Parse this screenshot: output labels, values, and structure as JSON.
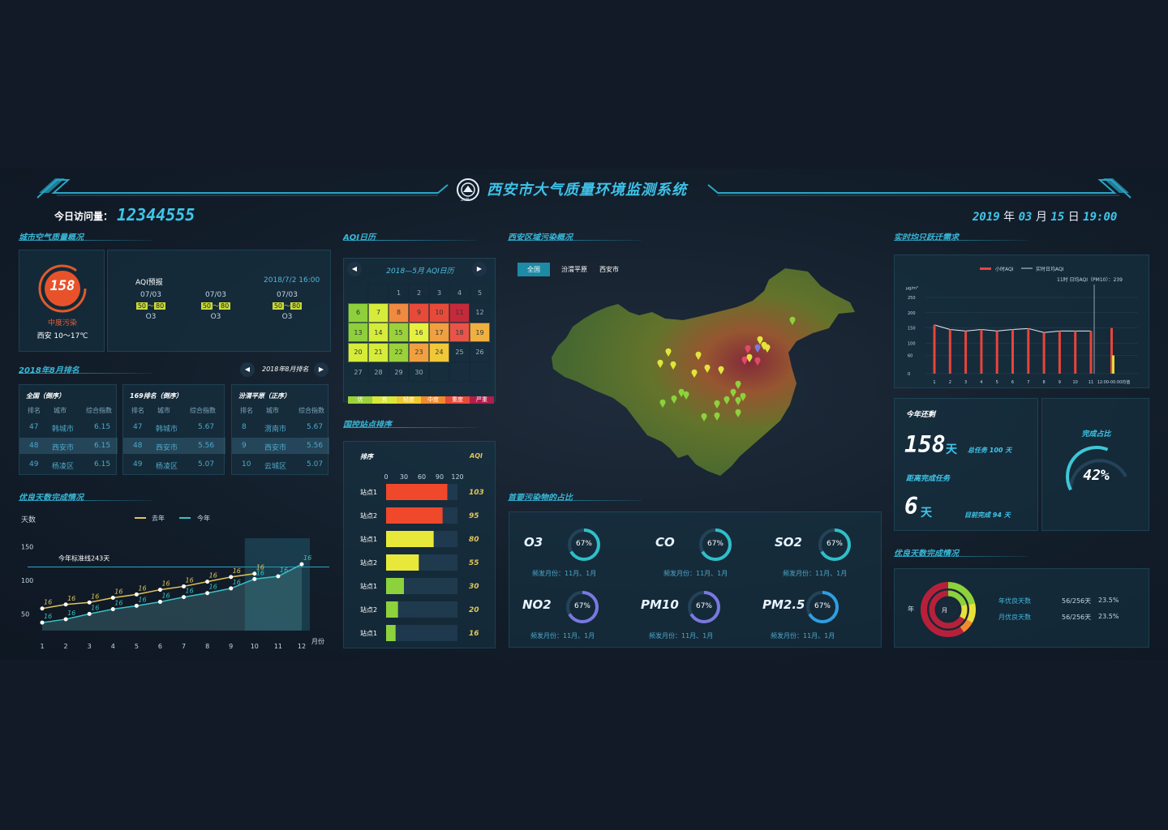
{
  "header": {
    "title": "西安市大气质量环境监测系统",
    "visits_label": "今日访问量：",
    "visits_value": "12344555",
    "date": {
      "year": "2019",
      "year_unit": "年",
      "month": "03",
      "month_unit": "月",
      "day": "15",
      "day_unit": "日",
      "time": "19:00"
    },
    "logo_text": "ZHB"
  },
  "city_air": {
    "title": "城市空气质量概况",
    "aqi": "158",
    "level": "中度污染",
    "weather": "西安 10～17℃",
    "forecast_label": "AQI预报",
    "forecast_time": "2018/7/2 16:00",
    "forecasts": [
      {
        "date": "07/03",
        "low": "50",
        "high": "80",
        "pollutant": "O3"
      },
      {
        "date": "07/03",
        "low": "50",
        "high": "80",
        "pollutant": "O3"
      },
      {
        "date": "07/03",
        "low": "50",
        "high": "80",
        "pollutant": "O3"
      }
    ]
  },
  "ranking": {
    "title": "2018年8月排名",
    "nav_label": "2018年8月排名",
    "tables": [
      {
        "title": "全国（倒序）",
        "headers": [
          "排名",
          "城市",
          "综合指数"
        ],
        "rows": [
          [
            "47",
            "韩城市",
            "6.15"
          ],
          [
            "48",
            "西安市",
            "6.15"
          ],
          [
            "49",
            "杨凌区",
            "6.15"
          ]
        ]
      },
      {
        "title": "169排名（倒序）",
        "headers": [
          "排名",
          "城市",
          "综合指数"
        ],
        "rows": [
          [
            "47",
            "韩城市",
            "5.67"
          ],
          [
            "48",
            "西安市",
            "5.56"
          ],
          [
            "49",
            "杨凌区",
            "5.07"
          ]
        ]
      },
      {
        "title": "汾渭平原（正序）",
        "headers": [
          "排名",
          "城市",
          "综合指数"
        ],
        "rows": [
          [
            "8",
            "渭南市",
            "5.67"
          ],
          [
            "9",
            "西安市",
            "5.56"
          ],
          [
            "10",
            "云城区",
            "5.07"
          ]
        ]
      }
    ]
  },
  "good_days": {
    "title": "优良天数完成情况",
    "y_title": "天数",
    "x_unit": "月份",
    "legend": [
      "去年",
      "今年"
    ],
    "standard_label": "今年标准线243天",
    "colors": {
      "last": "#e0c45a",
      "this": "#39c2c6"
    }
  },
  "chart_data": [
    {
      "type": "line",
      "ylabel": "天数",
      "xlabel": "月份",
      "categories": [
        "1",
        "2",
        "3",
        "4",
        "5",
        "6",
        "7",
        "8",
        "9",
        "10",
        "11",
        "12"
      ],
      "ylim": [
        25,
        175
      ],
      "yticks": [
        "150",
        "100",
        "50"
      ],
      "reference_line": 120,
      "series": [
        {
          "name": "去年",
          "values": [
            58,
            64,
            67,
            74,
            79,
            86,
            91,
            98,
            105,
            110,
            null,
            null
          ]
        },
        {
          "name": "今年",
          "values": [
            37,
            42,
            50,
            57,
            62,
            68,
            75,
            81,
            88,
            102,
            106,
            124
          ]
        }
      ],
      "point_label": "16"
    },
    {
      "type": "bar",
      "categories": [
        "站点1",
        "站点2",
        "站点1",
        "站点2",
        "站点1",
        "站点2",
        "站点1"
      ],
      "values": [
        103,
        95,
        80,
        55,
        30,
        20,
        16
      ],
      "ylabel": "AQI",
      "xlabel": "排序",
      "xticks": [
        "0",
        "30",
        "60",
        "90",
        "120"
      ],
      "xlim": [
        0,
        120
      ]
    },
    {
      "type": "bar",
      "legend": [
        "小时AQI",
        "实时日均AQI"
      ],
      "annotation": "11时 日均AQI（PM10）：239",
      "unit": "μg/m³",
      "yticks": [
        "250",
        "200",
        "150",
        "100",
        "60",
        "0"
      ],
      "categories": [
        "1",
        "2",
        "3",
        "4",
        "5",
        "6",
        "7",
        "8",
        "9",
        "10",
        "11",
        "12:00-00:00均值"
      ],
      "values": [
        160,
        145,
        140,
        145,
        140,
        145,
        148,
        135,
        140,
        140,
        140,
        150
      ]
    }
  ],
  "aqi_calendar": {
    "title": "AQI日历",
    "month_label": "2018—5月 AQI日历",
    "legend": [
      "优",
      "良",
      "轻度",
      "中度",
      "重度",
      "严重"
    ],
    "legend_colors": [
      "#9bd23c",
      "#d8e83a",
      "#f0c830",
      "#f08a2c",
      "#e84a3a",
      "#b01e4a"
    ],
    "row0": [
      "",
      "",
      "1",
      "2",
      "3",
      "4",
      "5"
    ],
    "row1": [
      "6",
      "7",
      "8",
      "9",
      "10",
      "11",
      "12"
    ],
    "row2": [
      "13",
      "14",
      "15",
      "16",
      "17",
      "18",
      "19"
    ],
    "row3": [
      "20",
      "21",
      "22",
      "23",
      "24",
      "25",
      "26"
    ],
    "row4": [
      "27",
      "28",
      "29",
      "30",
      "",
      "",
      ""
    ],
    "colors_row1": [
      "#8ed03c",
      "#d6ec3a",
      "#f08a40",
      "#e84a3a",
      "#e84a3a",
      "#c42a3a",
      ""
    ],
    "colors_row2": [
      "#8ed03c",
      "#d6ec3a",
      "#9bd23c",
      "#e6f040",
      "#f0a040",
      "#e8544a",
      "#f0b040"
    ],
    "colors_row3": [
      "#d6ec3a",
      "#d6ec3a",
      "#9bd23c",
      "#f0a040",
      "#f0c838",
      "",
      ""
    ]
  },
  "station_rank": {
    "title": "国控站点排序",
    "col_sort": "排序",
    "col_aqi": "AQI"
  },
  "region": {
    "title": "西安区域污染概况",
    "tabs": [
      "全国",
      "汾渭平原",
      "西安市"
    ]
  },
  "pollutants": {
    "title": "首要污染物的占比",
    "items": [
      {
        "name": "O3",
        "pct": "67%",
        "note": "频发月份：11月、1月",
        "color": "#2fbfc8"
      },
      {
        "name": "CO",
        "pct": "67%",
        "note": "频发月份：11月、1月",
        "color": "#2fbfc8"
      },
      {
        "name": "SO2",
        "pct": "67%",
        "note": "频发月份：11月、1月",
        "color": "#2fbfc8"
      },
      {
        "name": "NO2",
        "pct": "67%",
        "note": "频发月份：11月、1月",
        "color": "#7a78e0"
      },
      {
        "name": "PM10",
        "pct": "67%",
        "note": "频发月份：11月、1月",
        "color": "#7a78e0"
      },
      {
        "name": "PM2.5",
        "pct": "67%",
        "note": "频发月份：11月、1月",
        "color": "#2f9ee0"
      }
    ],
    "fraction": 0.67
  },
  "realtime": {
    "title": "实时均只跃迁需求"
  },
  "remain": {
    "label": "今年还剩",
    "days": "158",
    "day_unit": "天",
    "total_label": "总任务 100 天",
    "gap_label": "距离完成任务",
    "gap_days": "6",
    "gap_unit": "天",
    "done_label": "目前完成 94 天",
    "ratio_label": "完成占比",
    "ratio": "42%",
    "ratio_value": 0.42
  },
  "good_days2": {
    "title": "优良天数完成情况",
    "outer_label": "年",
    "inner_label": "月",
    "rows": [
      {
        "label": "年优良天数",
        "count": "56/256天",
        "pct": "23.5%"
      },
      {
        "label": "月优良天数",
        "count": "56/256天",
        "pct": "23.5%"
      }
    ]
  }
}
